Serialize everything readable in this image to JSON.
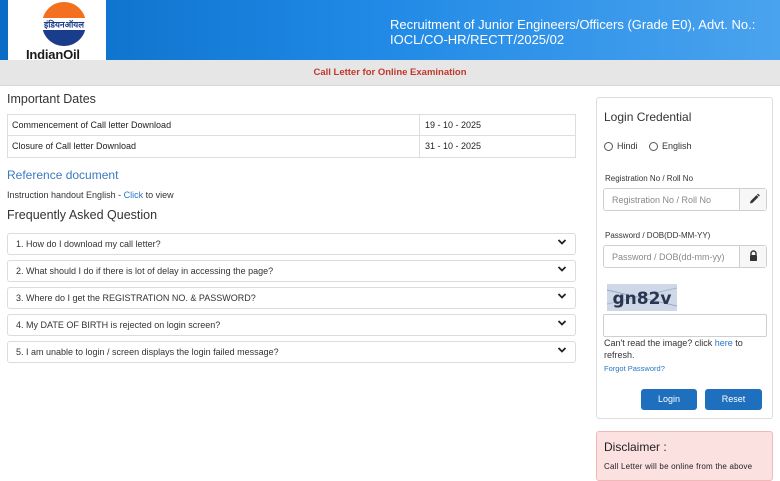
{
  "header": {
    "logo_text": "IndianOil",
    "logo_hindi": "इंडियनऑयल",
    "title": "Recruitment of Junior Engineers/Officers (Grade E0), Advt. No.: IOCL/CO-HR/RECTT/2025/02",
    "brand_color": "#1e88e5"
  },
  "subbar": {
    "text": "Call Letter for Online Examination",
    "color": "#c0392b"
  },
  "important_dates": {
    "title": "Important Dates",
    "rows": [
      {
        "label": "Commencement of Call letter Download",
        "value": "19 - 10 - 2025"
      },
      {
        "label": "Closure of Call letter Download",
        "value": "31 - 10 - 2025"
      }
    ]
  },
  "reference": {
    "title": "Reference document",
    "instruction_prefix": "Instruction handout English - ",
    "instruction_link": "Click",
    "instruction_suffix": " to view"
  },
  "faq": {
    "title": "Frequently Asked Question",
    "items": [
      {
        "q": "1. How do I download my call letter?"
      },
      {
        "q": "2. What should I do if there is lot of delay in accessing the page?"
      },
      {
        "q": "3. Where do I get the REGISTRATION NO. & PASSWORD?"
      },
      {
        "q": "4. My DATE OF BIRTH is rejected on login screen?"
      },
      {
        "q": "5. I am unable to login / screen displays the login failed message?"
      }
    ]
  },
  "login": {
    "title": "Login Credential",
    "lang_options": [
      "Hindi",
      "English"
    ],
    "reg_label": "Registration No / Roll No",
    "reg_placeholder": "Registration No / Roll No",
    "pwd_label": "Password / DOB(DD-MM-YY)",
    "pwd_placeholder": "Password / DOB(dd-mm-yy)",
    "captcha_text": "gn82v",
    "cant_read_prefix": "Can't read the image? click ",
    "cant_read_link": "here",
    "cant_read_suffix": " to refresh.",
    "forgot": "Forgot Password?",
    "login_button": "Login",
    "reset_button": "Reset",
    "button_color": "#1f6fbf"
  },
  "disclaimer": {
    "title": "Disclaimer :",
    "text": "Call Letter will be online from the above"
  }
}
